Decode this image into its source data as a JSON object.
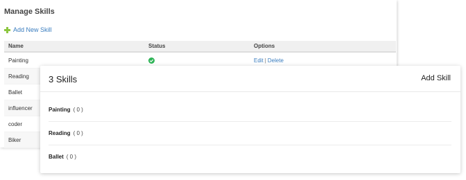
{
  "background_panel": {
    "title": "Manage Skills",
    "add_new_label": "Add New Skill",
    "columns": {
      "name": "Name",
      "status": "Status",
      "options": "Options"
    },
    "rows": [
      {
        "name": "Painting",
        "edit_label": "Edit",
        "separator": "|",
        "delete_label": "Delete"
      },
      {
        "name": "Reading"
      },
      {
        "name": "Ballet"
      },
      {
        "name": "influencer"
      },
      {
        "name": "coder"
      },
      {
        "name": "Biker"
      }
    ],
    "status_icon": "check-circle-icon",
    "colors": {
      "link": "#3a7dbf",
      "status_ok": "#2fb457",
      "add_icon": "#8cc63f"
    }
  },
  "skills_card": {
    "title": "3 Skills",
    "add_label": "Add Skill",
    "items": [
      {
        "name": "Painting",
        "count": "( 0 )"
      },
      {
        "name": "Reading",
        "count": "( 0 )"
      },
      {
        "name": "Ballet",
        "count": "( 0 )"
      }
    ]
  }
}
